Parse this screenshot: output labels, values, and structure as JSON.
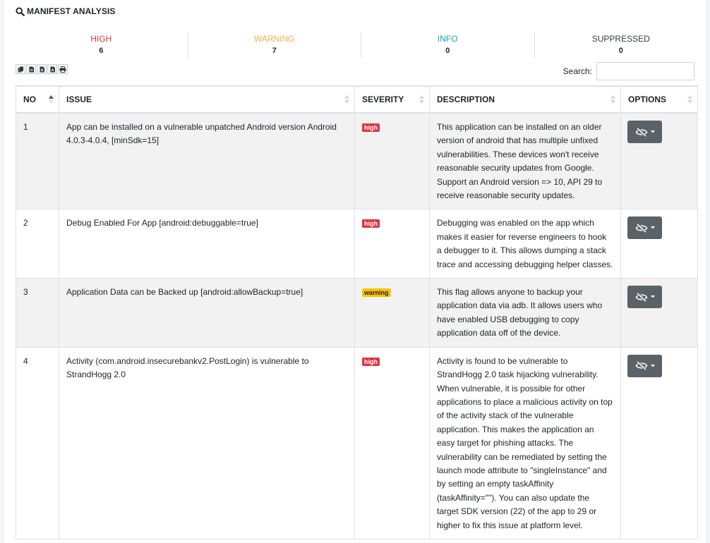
{
  "section": {
    "title": "MANIFEST ANALYSIS"
  },
  "stats": [
    {
      "label": "HIGH",
      "value": "6",
      "color": "#dc3545"
    },
    {
      "label": "WARNING",
      "value": "7",
      "color": "#f0ad4e"
    },
    {
      "label": "INFO",
      "value": "0",
      "color": "#17a2b8"
    },
    {
      "label": "SUPPRESSED",
      "value": "0",
      "color": "#343a40"
    }
  ],
  "toolbar": {
    "buttons": [
      "copy-icon",
      "csv-icon",
      "excel-icon",
      "pdf-icon",
      "print-icon"
    ],
    "search_label": "Search:",
    "search_value": ""
  },
  "table": {
    "columns": [
      "NO",
      "ISSUE",
      "SEVERITY",
      "DESCRIPTION",
      "OPTIONS"
    ],
    "rows": [
      {
        "no": "1",
        "issue": "App can be installed on a vulnerable unpatched Android version Android 4.0.3-4.0.4, [minSdk=15]",
        "severity": "high",
        "description": "This application can be installed on an older version of android that has multiple unfixed vulnerabilities. These devices won't receive reasonable security updates from Google. Support an Android version => 10, API 29 to receive reasonable security updates."
      },
      {
        "no": "2",
        "issue": "Debug Enabled For App [android:debuggable=true]",
        "severity": "high",
        "description": "Debugging was enabled on the app which makes it easier for reverse engineers to hook a debugger to it. This allows dumping a stack trace and accessing debugging helper classes."
      },
      {
        "no": "3",
        "issue": "Application Data can be Backed up [android:allowBackup=true]",
        "severity": "warning",
        "description": "This flag allows anyone to backup your application data via adb. It allows users who have enabled USB debugging to copy application data off of the device."
      },
      {
        "no": "4",
        "issue": "Activity (com.android.insecurebankv2.PostLogin) is vulnerable to StrandHogg 2.0",
        "severity": "high",
        "description": "Activity is found to be vulnerable to StrandHogg 2.0 task hijacking vulnerability. When vulnerable, it is possible for other applications to place a malicious activity on top of the activity stack of the vulnerable application. This makes the application an easy target for phishing attacks. The vulnerability can be remediated by setting the launch mode attribute to \"singleInstance\" and by setting an empty taskAffinity (taskAffinity=\"\"). You can also update the target SDK version (22) of the app to 29 or higher to fix this issue at platform level."
      }
    ]
  }
}
